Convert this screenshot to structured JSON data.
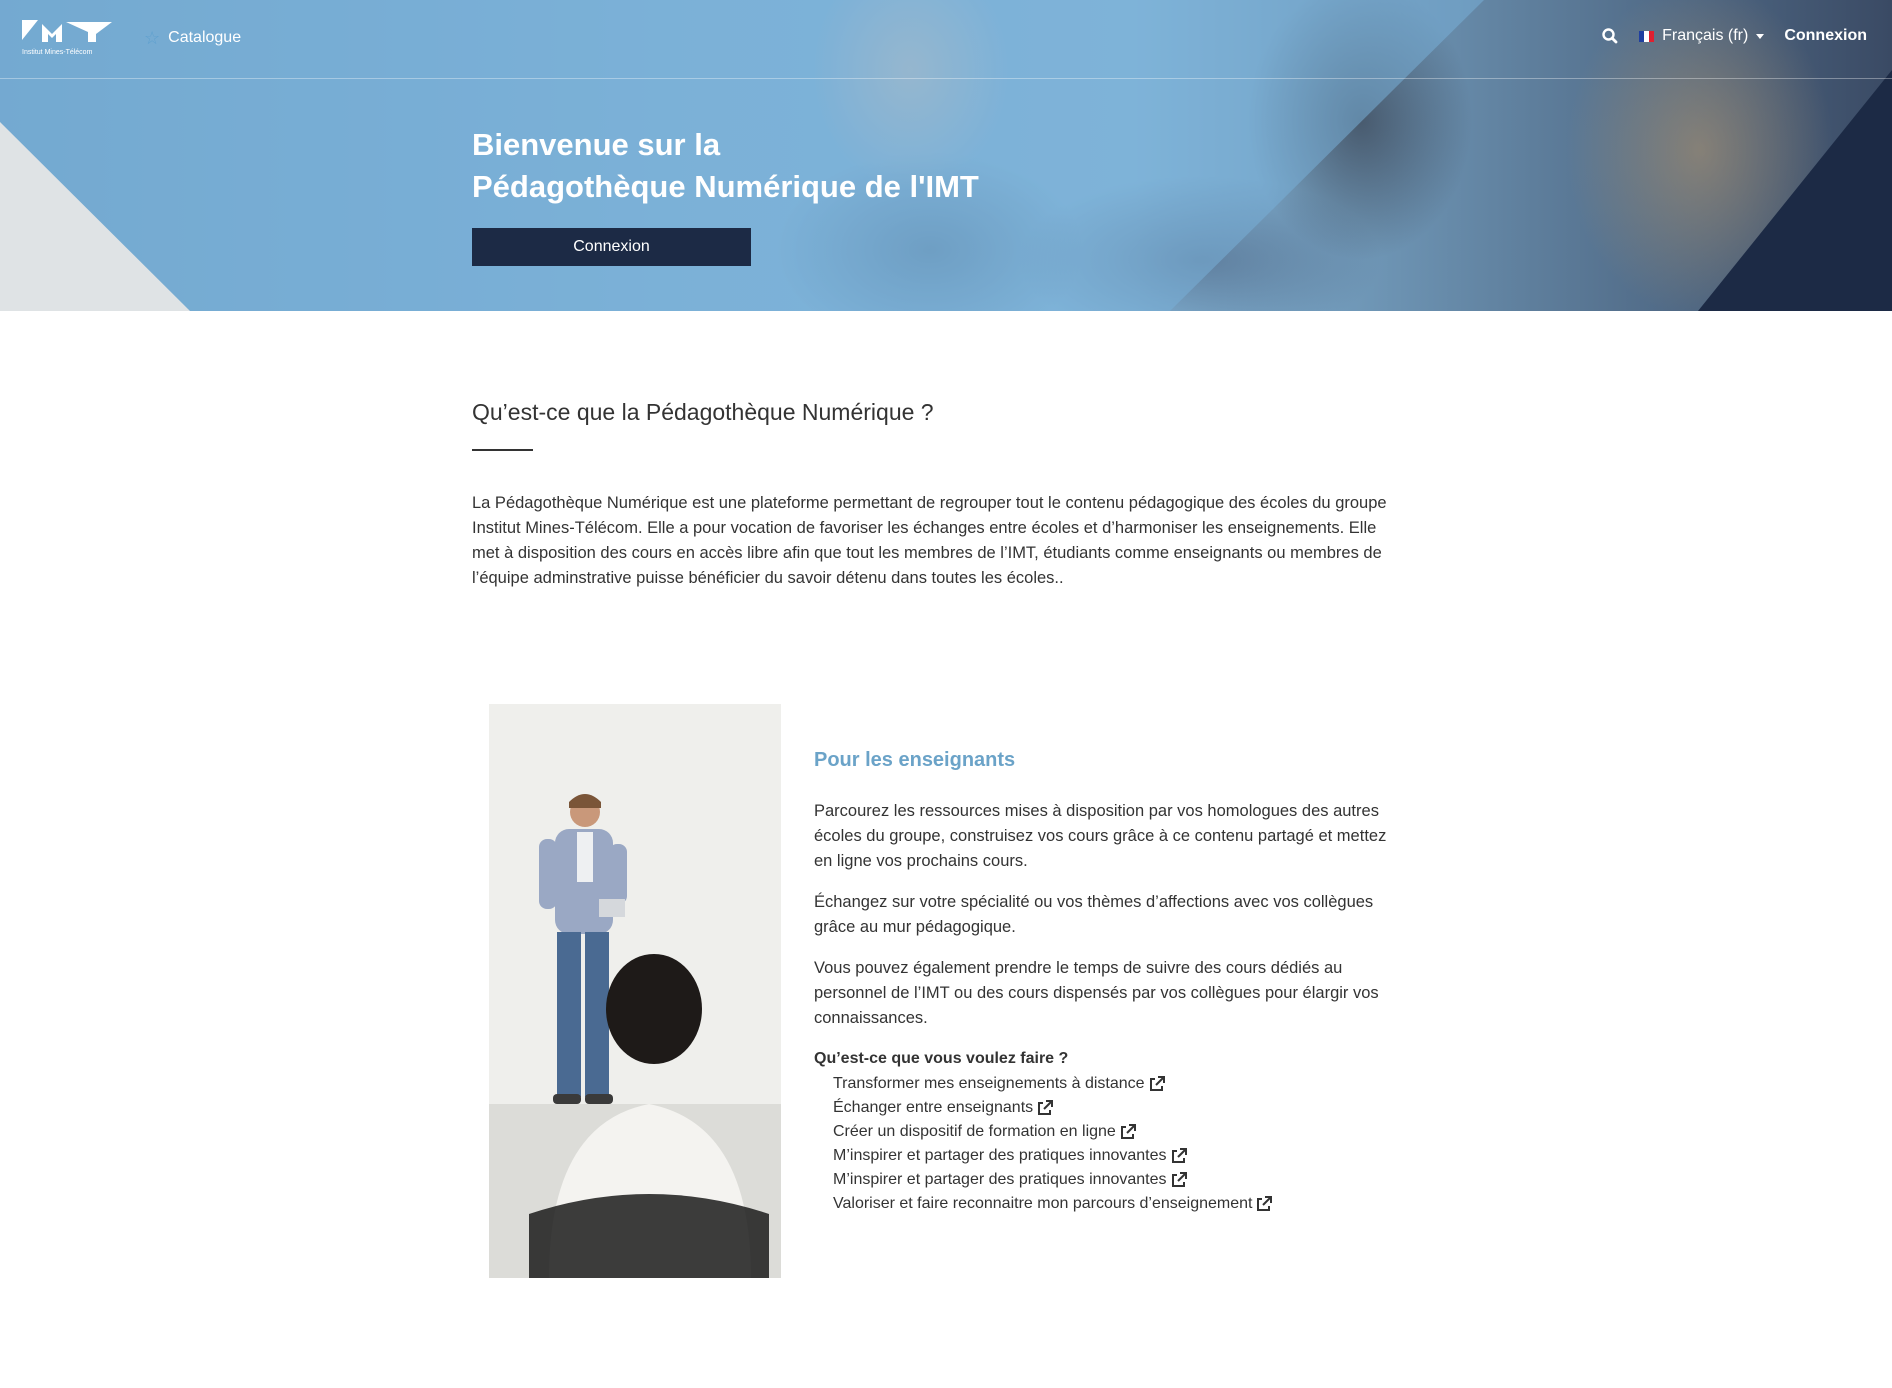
{
  "brand": {
    "logo_subtitle": "Institut Mines-Télécom"
  },
  "nav": {
    "catalogue_label": "Catalogue",
    "language_label": "Français (fr)",
    "login_label": "Connexion"
  },
  "hero": {
    "title_line1": "Bienvenue sur la",
    "title_line2": "Pédagothèque Numérique de l'IMT",
    "button_label": "Connexion"
  },
  "about": {
    "title": "Qu’est-ce que la Pédagothèque Numérique ?",
    "text": "La Pédagothèque Numérique est une plateforme permettant de regrouper tout le contenu pédagogique des écoles du groupe Institut Mines-Télécom. Elle a pour vocation de favoriser les échanges entre écoles et d’harmoniser les enseignements. Elle met à disposition des cours en accès libre afin que tout les membres de l’IMT, étudiants comme enseignants ou membres de l’équipe adminstrative puisse bénéficier du savoir détenu dans toutes les écoles.."
  },
  "teachers": {
    "title": "Pour les enseignants",
    "paragraphs": [
      "Parcourez les ressources mises à disposition par vos homologues des autres écoles du groupe, construisez vos cours grâce à ce contenu partagé et mettez en ligne vos prochains cours.",
      "Échangez sur votre spécialité ou vos thèmes d’affections avec vos collègues grâce au mur pédagogique.",
      "Vous pouvez également prendre le temps de suivre des cours dédiés au personnel de l’IMT ou des cours dispensés par vos collègues pour élargir vos connaissances."
    ],
    "question": "Qu’est-ce que vous voulez faire ?",
    "links": [
      "Transformer mes enseignements à distance",
      "Échanger entre enseignants",
      "Créer un dispositif de formation en ligne",
      "M’inspirer et partager des pratiques innovantes",
      "M’inspirer et partager des pratiques innovantes",
      "Valoriser et faire reconnaitre mon parcours d’enseignement"
    ]
  },
  "colors": {
    "navy": "#1c2a45",
    "accent_blue": "#6ba3c8",
    "hero_blue": "#7fb3d8",
    "text": "#333333"
  },
  "icons": [
    "star-icon",
    "search-icon",
    "flag-fr-icon",
    "caret-down-icon",
    "external-link-icon"
  ]
}
